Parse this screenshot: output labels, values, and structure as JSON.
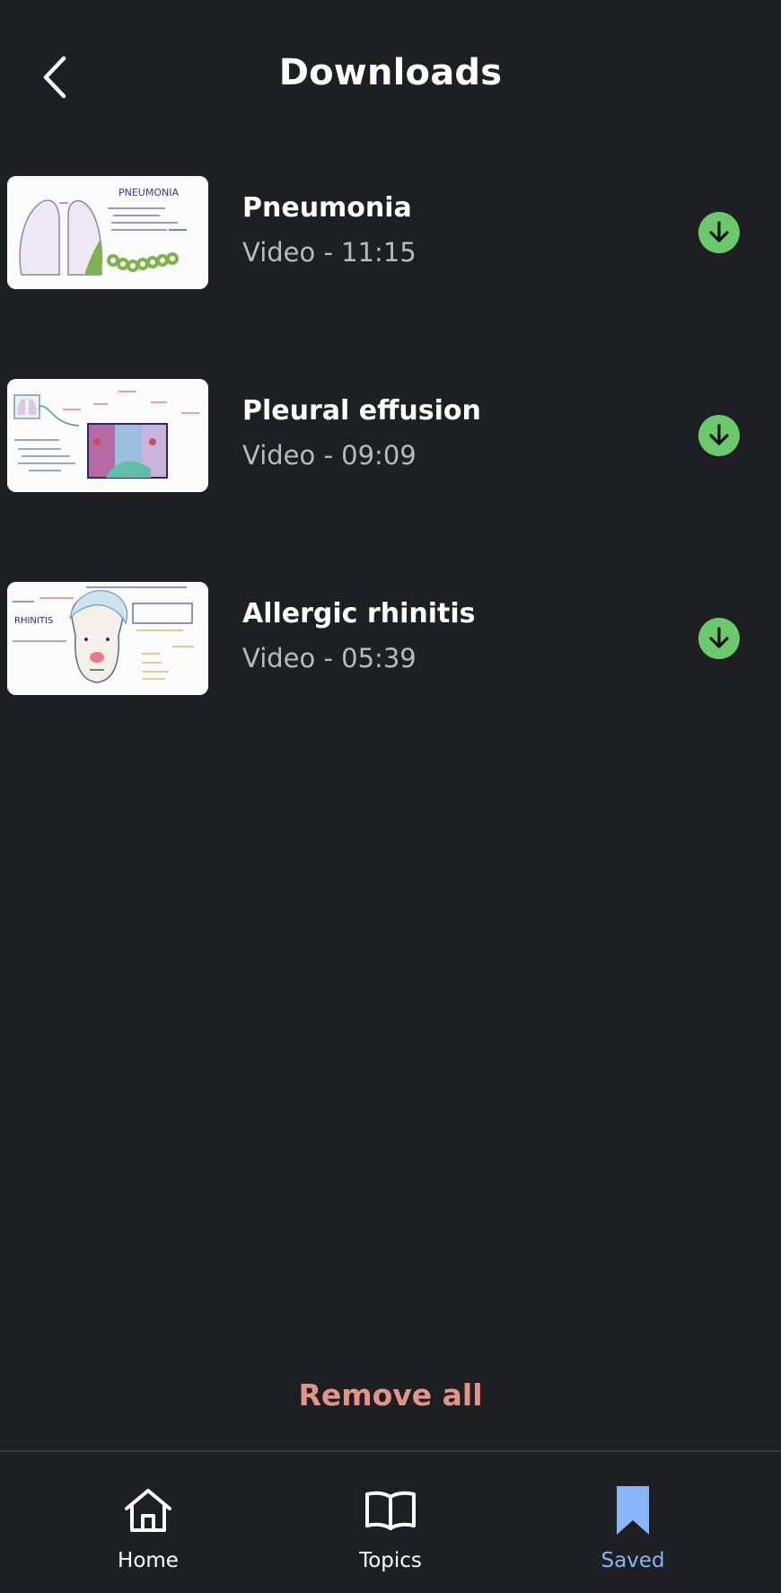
{
  "header": {
    "title": "Downloads"
  },
  "downloads": [
    {
      "title": "Pneumonia",
      "subtitle": "Video - 11:15"
    },
    {
      "title": "Pleural effusion",
      "subtitle": "Video - 09:09"
    },
    {
      "title": "Allergic rhinitis",
      "subtitle": "Video - 05:39"
    }
  ],
  "footer": {
    "remove_all_label": "Remove all"
  },
  "tabs": [
    {
      "label": "Home",
      "icon": "home-icon"
    },
    {
      "label": "Topics",
      "icon": "book-icon"
    },
    {
      "label": "Saved",
      "icon": "bookmark-icon",
      "active": true
    }
  ],
  "colors": {
    "background": "#1e1f23",
    "download_green": "#6cc96b",
    "remove_all": "#e29488",
    "active_tab": "#8ab4f8"
  }
}
